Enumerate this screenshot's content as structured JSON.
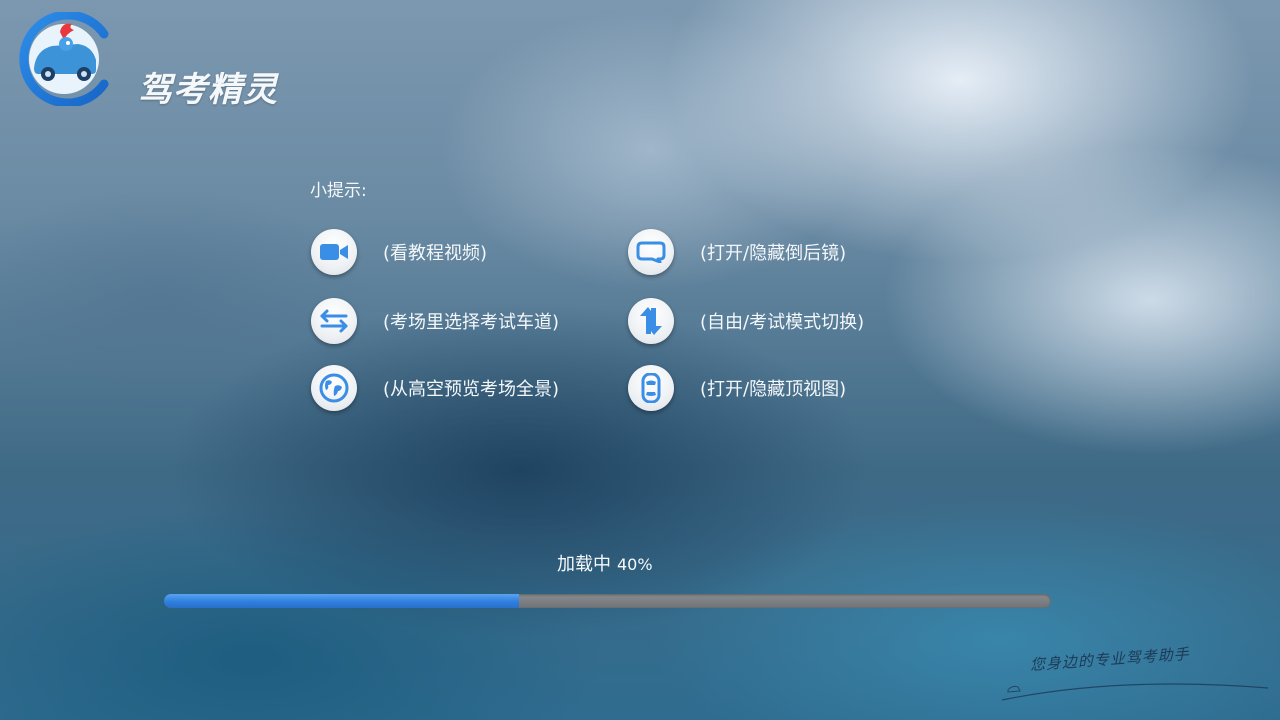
{
  "brand": {
    "name": "驾考精灵",
    "slogan": "您身边的专业驾考助手"
  },
  "tips": {
    "title": "小提示:",
    "items": [
      {
        "icon": "video-camera-icon",
        "label": "(看教程视频)"
      },
      {
        "icon": "rearview-mirror-icon",
        "label": "(打开/隐藏倒后镜)"
      },
      {
        "icon": "swap-lanes-icon",
        "label": "(考场里选择考试车道)"
      },
      {
        "icon": "mode-switch-icon",
        "label": "(自由/考试模式切换)"
      },
      {
        "icon": "globe-icon",
        "label": "(从高空预览考场全景)"
      },
      {
        "icon": "car-top-view-icon",
        "label": "(打开/隐藏顶视图)"
      }
    ]
  },
  "loading": {
    "label": "加载中",
    "percent_text": "40%",
    "progress": 0.4
  },
  "colors": {
    "accent": "#3a8ee6",
    "progress_fill": "#2f7fe0",
    "progress_track": "#7a7e82",
    "icon_bg": "#f2f4f6"
  }
}
